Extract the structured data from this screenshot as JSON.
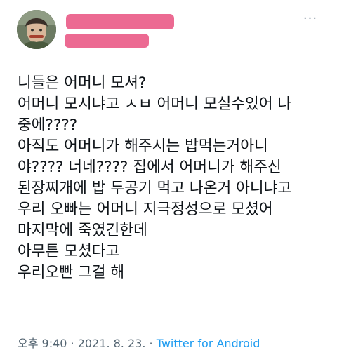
{
  "tweet": {
    "avatar_icon": "profile-avatar",
    "more_icon": "more-options-icon",
    "redaction_color": "#ec6a92",
    "lines": [
      "니들은 어머니 모셔?",
      "어머니 모시냐고 ㅅㅂ 어머니 모실수있어 나",
      "중에????",
      "아직도 어머니가 해주시는 밥먹는거아니",
      "야???? 너네???? 집에서 어머니가 해주신",
      "된장찌개에 밥 두공기 먹고 나온거 아니냐고",
      "우리 오빠는 어머니 지극정성으로 모셨어",
      "마지막에 죽였긴한데",
      "아무튼 모셨다고",
      "우리오빤 그걸 해"
    ],
    "meta": {
      "time": "오후 9:40",
      "sep1": " · ",
      "date": "2021. 8. 23.",
      "sep2": " · ",
      "source": "Twitter for Android",
      "source_color": "#1d9bf0"
    }
  }
}
